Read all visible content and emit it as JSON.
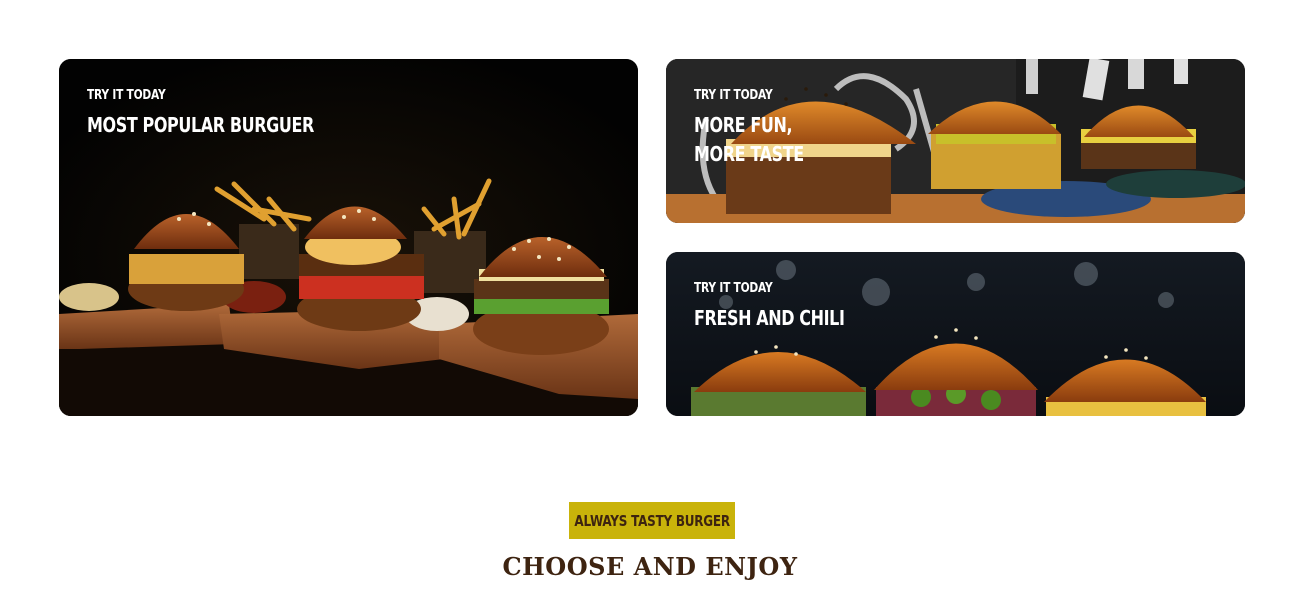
{
  "banners": [
    {
      "eyebrow": "TRY IT TODAY",
      "headline": "MOST POPULAR BURGUER"
    },
    {
      "eyebrow": "TRY IT TODAY",
      "headline_lines": [
        "MORE FUN,",
        "MORE TASTE"
      ]
    },
    {
      "eyebrow": "TRY IT TODAY",
      "headline": "FRESH AND CHILI"
    }
  ],
  "section": {
    "pill": "ALWAYS TASTY BURGER",
    "title": "CHOOSE AND ENJOY"
  },
  "colors": {
    "pill_bg": "#c9b30a",
    "title": "#3e2411",
    "banner_text": "#ffffff"
  }
}
